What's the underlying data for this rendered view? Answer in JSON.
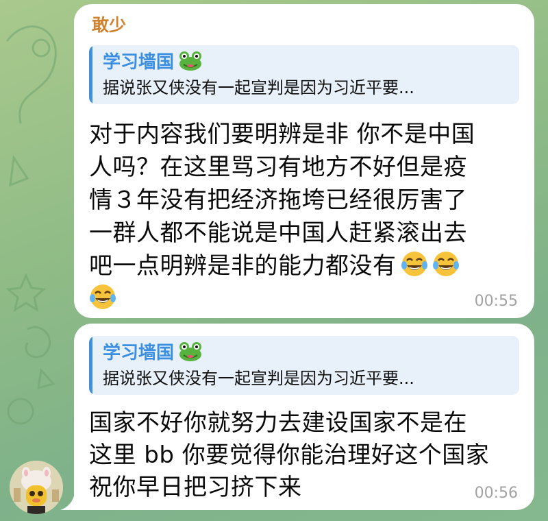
{
  "colors": {
    "sender": "#d0822f",
    "quote_accent": "#3f8fd9",
    "bubble": "#ffffff",
    "background": "#8fbb86"
  },
  "messages": [
    {
      "sender": "敢少",
      "reply_to": {
        "author": "学习墙国",
        "author_icon": "frog-icon",
        "text": "据说张又侠没有一起宣判是因为习近平要..."
      },
      "lines": [
        "对于内容我们要明辨是非 你不是中国",
        "人吗？在这里骂习有地方不好但是疫",
        "情３年没有把经济拖垮已经很厉害了",
        "一群人都不能说是中国人赶紧滚出去",
        "吧一点明辨是非的能力都没有"
      ],
      "time": "00:55"
    },
    {
      "reply_to": {
        "author": "学习墙国",
        "author_icon": "frog-icon",
        "text": "据说张又侠没有一起宣判是因为习近平要..."
      },
      "lines": [
        "国家不好你就努力去建设国家不是在",
        "这里 bb 你要觉得你能治理好这个国家",
        "祝你早日把习挤下来"
      ],
      "time": "00:56"
    }
  ]
}
